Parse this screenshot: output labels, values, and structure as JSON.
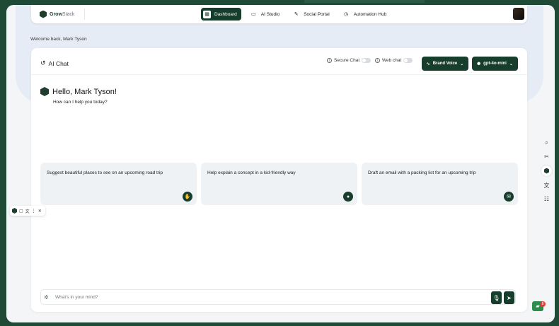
{
  "brand": {
    "name_bold": "Grow",
    "name_light": "Stack"
  },
  "nav": [
    {
      "label": "Dashboard",
      "icon": "grid-icon",
      "active": true
    },
    {
      "label": "AI Studio",
      "icon": "image-icon",
      "active": false
    },
    {
      "label": "Social Portal",
      "icon": "pen-icon",
      "active": false
    },
    {
      "label": "Automation Hub",
      "icon": "clock-icon",
      "active": false
    }
  ],
  "welcome": "Welcome back, Mark Tyson",
  "chat": {
    "title": "AI Chat",
    "secure_label": "Secure Chat",
    "web_label": "Web chat",
    "brand_voice": "Brand Voice",
    "model": "gpt-4o-mini",
    "greeting": "Hello, Mark Tyson!",
    "subtitle": "How can I help you today?",
    "suggestions": [
      {
        "text": "Suggest beautiful places to see on an upcoming road trip",
        "icon": "hand-icon"
      },
      {
        "text": "Help explain a concept in a kid-friendly way",
        "icon": "bulb-icon"
      },
      {
        "text": "Draft an email with a packing list for an upcoming trip",
        "icon": "mail-icon"
      }
    ],
    "input_placeholder": "What's in your mind?"
  },
  "chat_badge_count": "8",
  "colors": {
    "primary": "#173d2c",
    "frame": "#1f4a36",
    "accent_green": "#2c8c4d"
  }
}
